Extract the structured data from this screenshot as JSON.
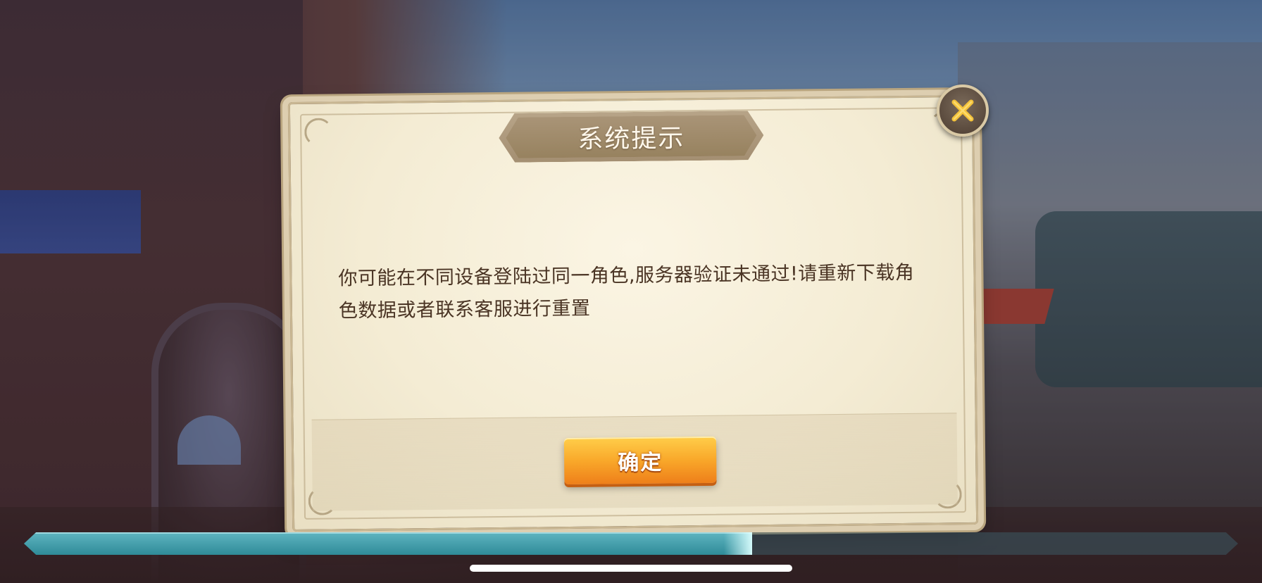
{
  "dialog": {
    "title": "系统提示",
    "message": "你可能在不同设备登陆过同一角色,服务器验证未通过!请重新下载角色数据或者联系客服进行重置",
    "confirm_label": "确定"
  },
  "loading": {
    "progress_fraction": 0.6
  },
  "colors": {
    "button_orange": "#f9a82a",
    "close_x_gold": "#f4c23a",
    "progress_teal": "#2f8b98"
  },
  "icons": {
    "close": "close-icon"
  }
}
